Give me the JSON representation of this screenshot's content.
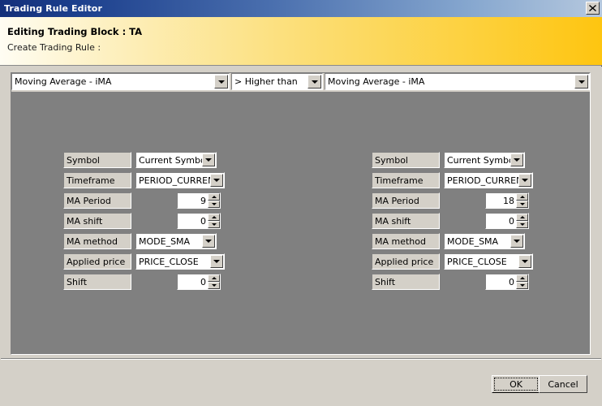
{
  "window": {
    "title": "Trading Rule Editor",
    "close_icon": "close-icon"
  },
  "header": {
    "title": "Editing Trading Block : TA",
    "subtitle": "Create Trading Rule :"
  },
  "rule": {
    "left_indicator": "Moving Average - iMA",
    "operator": "> Higher than",
    "right_indicator": "Moving Average - iMA"
  },
  "left_params": {
    "rows": [
      {
        "label": "Symbol",
        "type": "combo",
        "value": "Current Symbol"
      },
      {
        "label": "Timeframe",
        "type": "combo",
        "value": "PERIOD_CURRENT"
      },
      {
        "label": "MA Period",
        "type": "spinner",
        "value": "9"
      },
      {
        "label": "MA shift",
        "type": "spinner",
        "value": "0"
      },
      {
        "label": "MA method",
        "type": "combo",
        "value": "MODE_SMA"
      },
      {
        "label": "Applied price",
        "type": "combo",
        "value": "PRICE_CLOSE"
      },
      {
        "label": "Shift",
        "type": "spinner",
        "value": "0"
      }
    ]
  },
  "right_params": {
    "rows": [
      {
        "label": "Symbol",
        "type": "combo",
        "value": "Current Symbol"
      },
      {
        "label": "Timeframe",
        "type": "combo",
        "value": "PERIOD_CURRENT"
      },
      {
        "label": "MA Period",
        "type": "spinner",
        "value": "18"
      },
      {
        "label": "MA shift",
        "type": "spinner",
        "value": "0"
      },
      {
        "label": "MA method",
        "type": "combo",
        "value": "MODE_SMA"
      },
      {
        "label": "Applied price",
        "type": "combo",
        "value": "PRICE_CLOSE"
      },
      {
        "label": "Shift",
        "type": "spinner",
        "value": "0"
      }
    ]
  },
  "footer": {
    "ok_label": "OK",
    "cancel_label": "Cancel"
  },
  "colors": {
    "titlebar_start": "#14307a",
    "titlebar_end": "#b5c8de",
    "header_start": "#fffdf3",
    "header_end": "#fec510",
    "dialog_face": "#d4d0c8",
    "panel": "#808080"
  }
}
